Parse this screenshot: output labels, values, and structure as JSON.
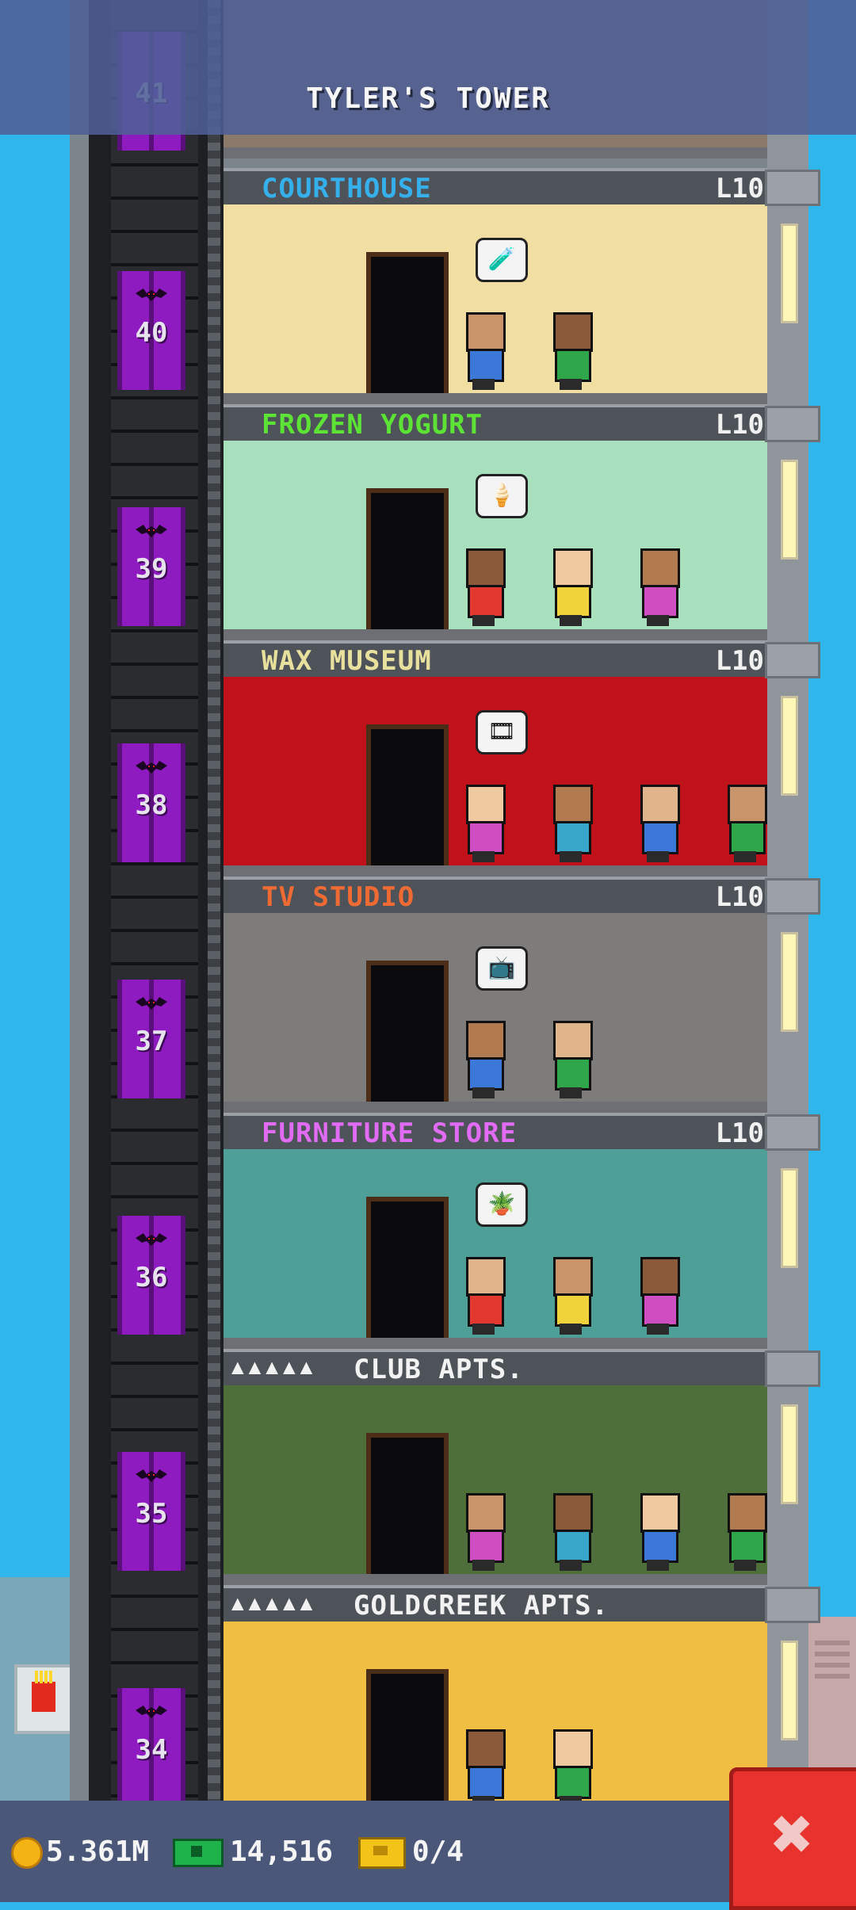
{
  "header": {
    "title": "TYLER'S TOWER"
  },
  "top_floor": {
    "elevator_number": "41"
  },
  "floors": [
    {
      "name": "COURTHOUSE",
      "level": "L10",
      "name_color": "#36b0ea",
      "elevator_number": "40",
      "bubble": "🧪"
    },
    {
      "name": "FROZEN YOGURT",
      "level": "L10",
      "name_color": "#5de336",
      "elevator_number": "39",
      "bubble": "🍦"
    },
    {
      "name": "WAX MUSEUM",
      "level": "L10",
      "name_color": "#e8e19e",
      "elevator_number": "38",
      "bubble": "🎞"
    },
    {
      "name": "TV STUDIO",
      "level": "L10",
      "name_color": "#f06a34",
      "elevator_number": "37",
      "bubble": "📺"
    },
    {
      "name": "FURNITURE STORE",
      "level": "L10",
      "name_color": "#e16bf2",
      "elevator_number": "36",
      "bubble": "🪴"
    },
    {
      "name": "CLUB APTS.",
      "level": "",
      "name_color": "#f2f2f2",
      "elevator_number": "35",
      "stars": "▲▲▲▲▲"
    },
    {
      "name": "GOLDCREEK APTS.",
      "level": "",
      "name_color": "#f2f2f2",
      "elevator_number": "34",
      "stars": "▲▲▲▲▲"
    }
  ],
  "bottom_bar": {
    "coins": "5.361M",
    "bux": "14,516",
    "tickets": "0/4",
    "close_label": "✖"
  },
  "colors": {
    "sky": "#2fb6ea",
    "elevator": "#8e1bc0",
    "close_button": "#e8322e"
  }
}
